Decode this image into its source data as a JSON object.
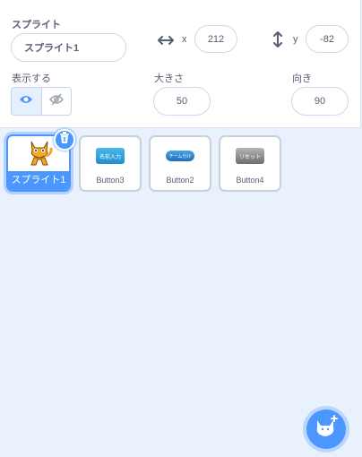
{
  "sprite_info": {
    "sprite_label": "スプライト",
    "sprite_name": "スプライト1",
    "x_label": "x",
    "x_value": "212",
    "y_label": "y",
    "y_value": "-82",
    "show_label": "表示する",
    "size_label": "大きさ",
    "size_value": "50",
    "direction_label": "向き",
    "direction_value": "90",
    "visible": true
  },
  "sprites": [
    {
      "name": "スプライト1",
      "selected": true,
      "thumbnail": "cat"
    },
    {
      "name": "Button3",
      "selected": false,
      "thumbnail_text": "名前入力"
    },
    {
      "name": "Button2",
      "selected": false,
      "thumbnail_text": "チーム分け"
    },
    {
      "name": "Button4",
      "selected": false,
      "thumbnail_text": "リセット"
    }
  ],
  "colors": {
    "accent": "#4c97ff",
    "panel_bg": "#e9f1fc",
    "text": "#575e75"
  },
  "icons": {
    "x_axis": "horizontal-arrows-icon",
    "y_axis": "vertical-arrows-icon",
    "show": "eye-icon",
    "hide": "eye-slash-icon",
    "delete": "trash-icon",
    "add_sprite": "cat-add-icon"
  }
}
